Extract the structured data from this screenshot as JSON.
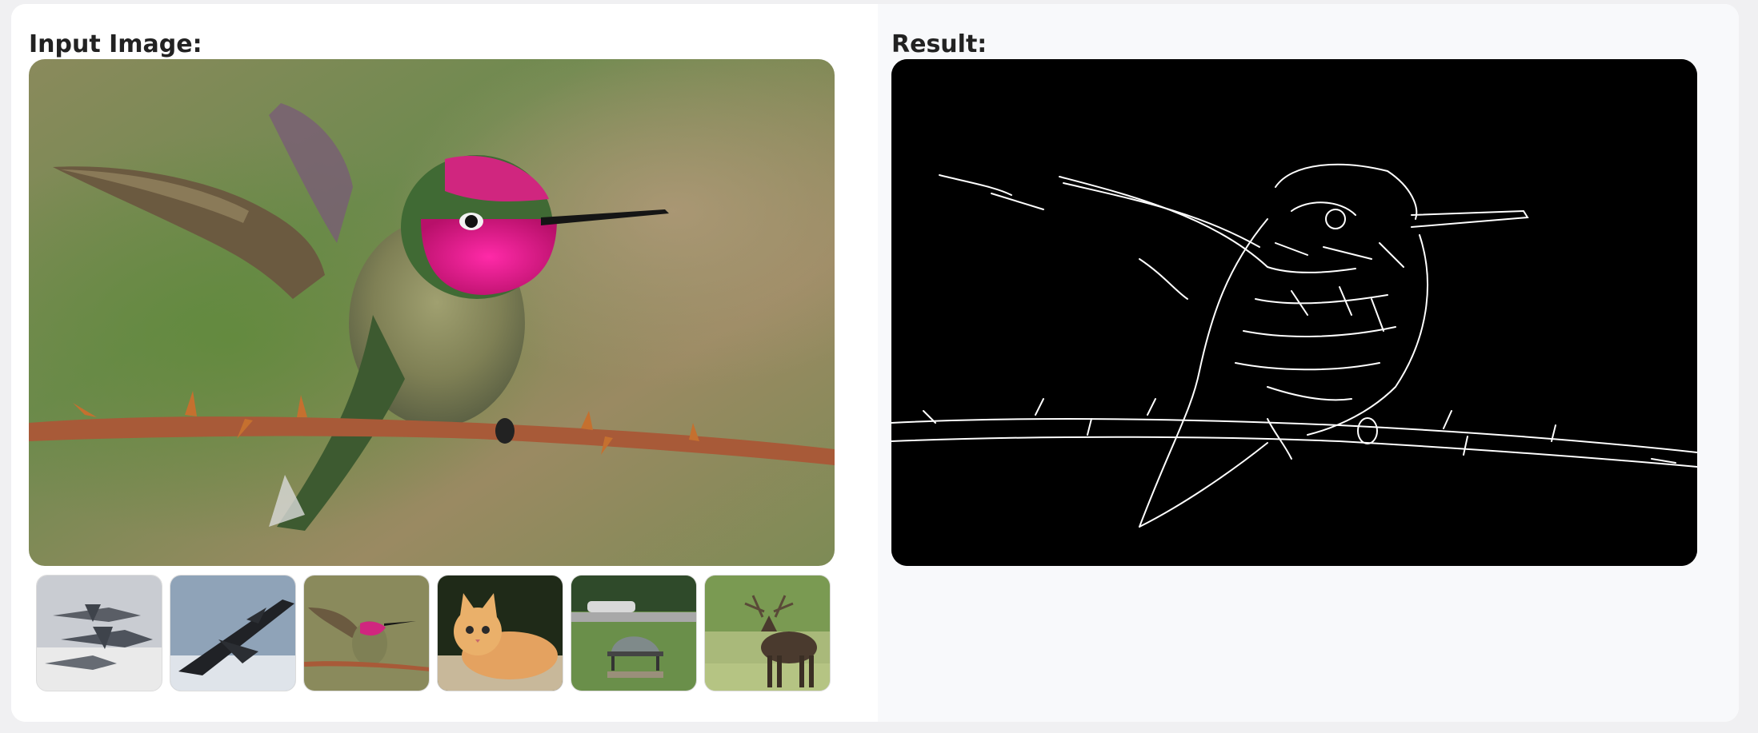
{
  "input_panel": {
    "title": "Input Image:",
    "main_image": {
      "subject": "hummingbird-on-thorny-branch"
    }
  },
  "result_panel": {
    "title": "Result:",
    "result_image": {
      "subject": "edge-detection-output-hummingbird",
      "style": "white edges on black"
    }
  },
  "examples": [
    {
      "subject": "fighter-jets-formation"
    },
    {
      "subject": "black-fighter-jet-in-clouds"
    },
    {
      "subject": "hummingbird-on-branch"
    },
    {
      "subject": "orange-kitten"
    },
    {
      "subject": "park-bench"
    },
    {
      "subject": "deer-in-field"
    }
  ],
  "colors": {
    "result_background": "#000000",
    "right_pane_background": "#f8f9fb",
    "card_background": "#ffffff"
  }
}
